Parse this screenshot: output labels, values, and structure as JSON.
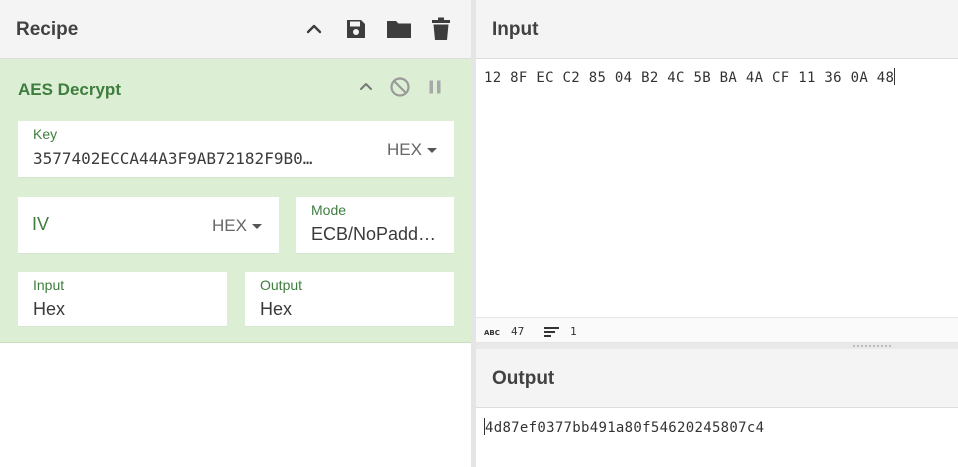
{
  "recipe": {
    "title": "Recipe"
  },
  "operation": {
    "name": "AES Decrypt",
    "key": {
      "label": "Key",
      "value": "3577402ECCA44A3F9AB72182F9B0…",
      "format": "HEX"
    },
    "iv": {
      "placeholder": "IV",
      "format": "HEX"
    },
    "mode": {
      "label": "Mode",
      "value": "ECB/NoPadd…"
    },
    "input": {
      "label": "Input",
      "value": "Hex"
    },
    "output": {
      "label": "Output",
      "value": "Hex"
    }
  },
  "input_pane": {
    "title": "Input",
    "text": "12 8F EC C2 85 04 B2 4C 5B BA 4A CF 11 36 0A 48",
    "char_count": "47",
    "line_count": "1"
  },
  "output_pane": {
    "title": "Output",
    "text": "4d87ef0377bb491a80f54620245807c4"
  },
  "colors": {
    "operation_bg": "#dcefd5",
    "operation_accent": "#3e7d3e",
    "header_bg": "#f4f4f4"
  },
  "icons": [
    "chevron-up-icon",
    "save-icon",
    "folder-icon",
    "trash-icon",
    "disable-icon",
    "pause-icon",
    "abc-icon",
    "lines-icon"
  ]
}
